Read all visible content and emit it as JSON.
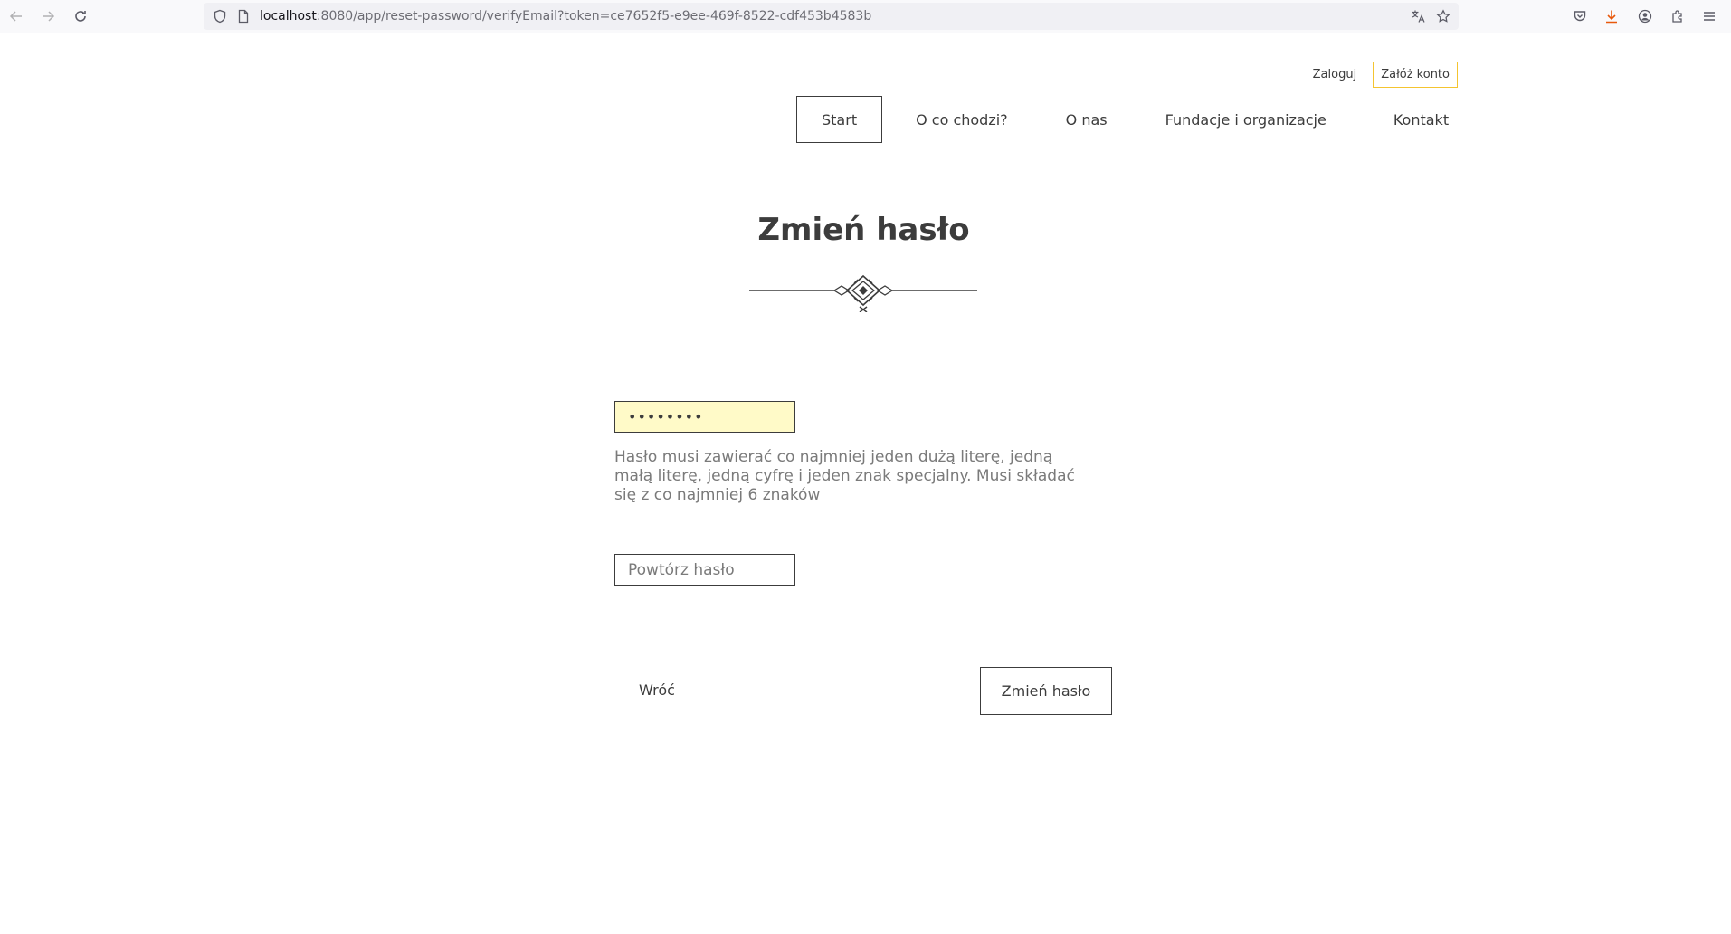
{
  "browser": {
    "url_host": "localhost",
    "url_rest": ":8080/app/reset-password/verifyEmail?token=ce7652f5-e9ee-469f-8522-cdf453b4583b",
    "icons": [
      "back-arrow-icon",
      "forward-arrow-icon",
      "reload-icon",
      "shield-icon",
      "page-icon",
      "translate-icon",
      "bookmark-star-icon",
      "pocket-icon",
      "download-icon",
      "account-icon",
      "extensions-icon",
      "menu-icon"
    ],
    "download_color": "#e8590c"
  },
  "header": {
    "login_label": "Zaloguj",
    "register_label": "Załóż konto",
    "accent_color": "#f4c430"
  },
  "nav": {
    "items": [
      {
        "label": "Start",
        "active": true
      },
      {
        "label": "O co chodzi?"
      },
      {
        "label": "O nas"
      },
      {
        "label": "Fundacje i organizacje"
      },
      {
        "label": "Kontakt"
      }
    ]
  },
  "main": {
    "title": "Zmień hasło",
    "password_value": "password",
    "password_bg_color": "#fffac8",
    "hint": "Hasło musi zawierać co najmniej jeden dużą literę, jedną małą literę, jedną cyfrę i jeden znak specjalny. Musi składać się z co najmniej 6 znaków",
    "repeat_placeholder": "Powtórz hasło",
    "back_label": "Wróć",
    "submit_label": "Zmień hasło"
  }
}
